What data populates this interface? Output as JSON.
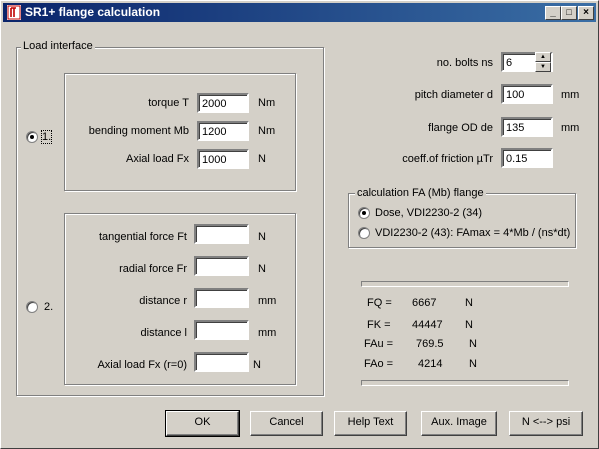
{
  "window": {
    "title": "SR1+  flange calculation",
    "controls": [
      "_",
      "□",
      "×"
    ]
  },
  "load_interface": {
    "title": "Load interface",
    "option1": {
      "label": "1.",
      "selected": true,
      "fields": [
        {
          "label": "torque T",
          "value": "2000",
          "unit": "Nm"
        },
        {
          "label": "bending moment Mb",
          "value": "1200",
          "unit": "Nm"
        },
        {
          "label": "Axial load Fx",
          "value": "1000",
          "unit": "N"
        }
      ]
    },
    "option2": {
      "label": "2.",
      "selected": false,
      "fields": [
        {
          "label": "tangential force Ft",
          "value": "",
          "unit": "N"
        },
        {
          "label": "radial force Fr",
          "value": "",
          "unit": "N"
        },
        {
          "label": "distance r",
          "value": "",
          "unit": "mm"
        },
        {
          "label": "distance l",
          "value": "",
          "unit": "mm"
        },
        {
          "label": "Axial load Fx (r=0)",
          "value": "",
          "unit": "N"
        }
      ]
    }
  },
  "right_fields": [
    {
      "label": "no. bolts ns",
      "value": "6",
      "unit": ""
    },
    {
      "label": "pitch diameter d",
      "value": "100",
      "unit": "mm"
    },
    {
      "label": "flange OD de",
      "value": "135",
      "unit": "mm"
    },
    {
      "label": "coeff.of friction µTr",
      "value": "0.15",
      "unit": ""
    }
  ],
  "calc_fa": {
    "title": "calculation FA (Mb) flange",
    "options": [
      {
        "label": "Dose, VDI2230-2 (34)",
        "selected": true
      },
      {
        "label": "VDI2230-2 (43): FAmax = 4*Mb / (ns*dt)",
        "selected": false
      }
    ]
  },
  "results": [
    {
      "label": "FQ =",
      "value": "6667",
      "unit": "N"
    },
    {
      "label": "FK =",
      "value": "44447",
      "unit": "N"
    },
    {
      "label": "FAu =",
      "value": "769.5",
      "unit": "N"
    },
    {
      "label": "FAo =",
      "value": "4214",
      "unit": "N"
    }
  ],
  "buttons": {
    "ok": "OK",
    "cancel": "Cancel",
    "help": "Help Text",
    "aux_image": "Aux. Image",
    "units": "N <--> psi"
  },
  "colors": {
    "title_bar_start": "#0a246a",
    "title_bar_end": "#3a6ea5",
    "dialog_bg": "#d4d0c8"
  }
}
